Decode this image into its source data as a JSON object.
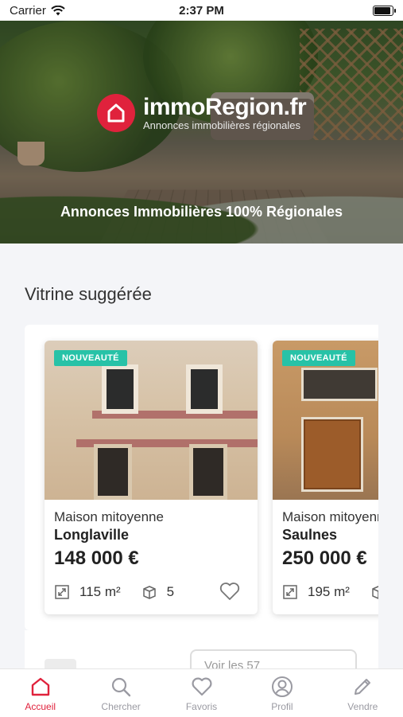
{
  "status_bar": {
    "carrier": "Carrier",
    "time": "2:37 PM"
  },
  "hero": {
    "brand_name": "immoRegion.fr",
    "brand_subtitle": "Annonces immobilières régionales",
    "tagline": "Annonces Immobilières 100% Régionales"
  },
  "showcase": {
    "title": "Vitrine suggérée",
    "listings": [
      {
        "badge": "NOUVEAUTÉ",
        "type": "Maison mitoyenne",
        "city": "Longlaville",
        "price": "148 000 €",
        "surface": "115 m²",
        "rooms": "5"
      },
      {
        "badge": "NOUVEAUTÉ",
        "type": "Maison mitoyenne",
        "city": "Saulnes",
        "price": "250 000 €",
        "surface": "195 m²",
        "rooms": ""
      }
    ]
  },
  "next_section": {
    "partial_text": "Voir les 57"
  },
  "tabbar": {
    "items": [
      {
        "label": "Accueil",
        "icon": "home-icon",
        "active": true
      },
      {
        "label": "Chercher",
        "icon": "search-icon",
        "active": false
      },
      {
        "label": "Favoris",
        "icon": "heart-icon",
        "active": false
      },
      {
        "label": "Profil",
        "icon": "user-icon",
        "active": false
      },
      {
        "label": "Vendre",
        "icon": "pencil-icon",
        "active": false
      }
    ]
  },
  "colors": {
    "brand": "#e0223c",
    "badge": "#27c2a7",
    "inactive": "#9a9aa2"
  }
}
